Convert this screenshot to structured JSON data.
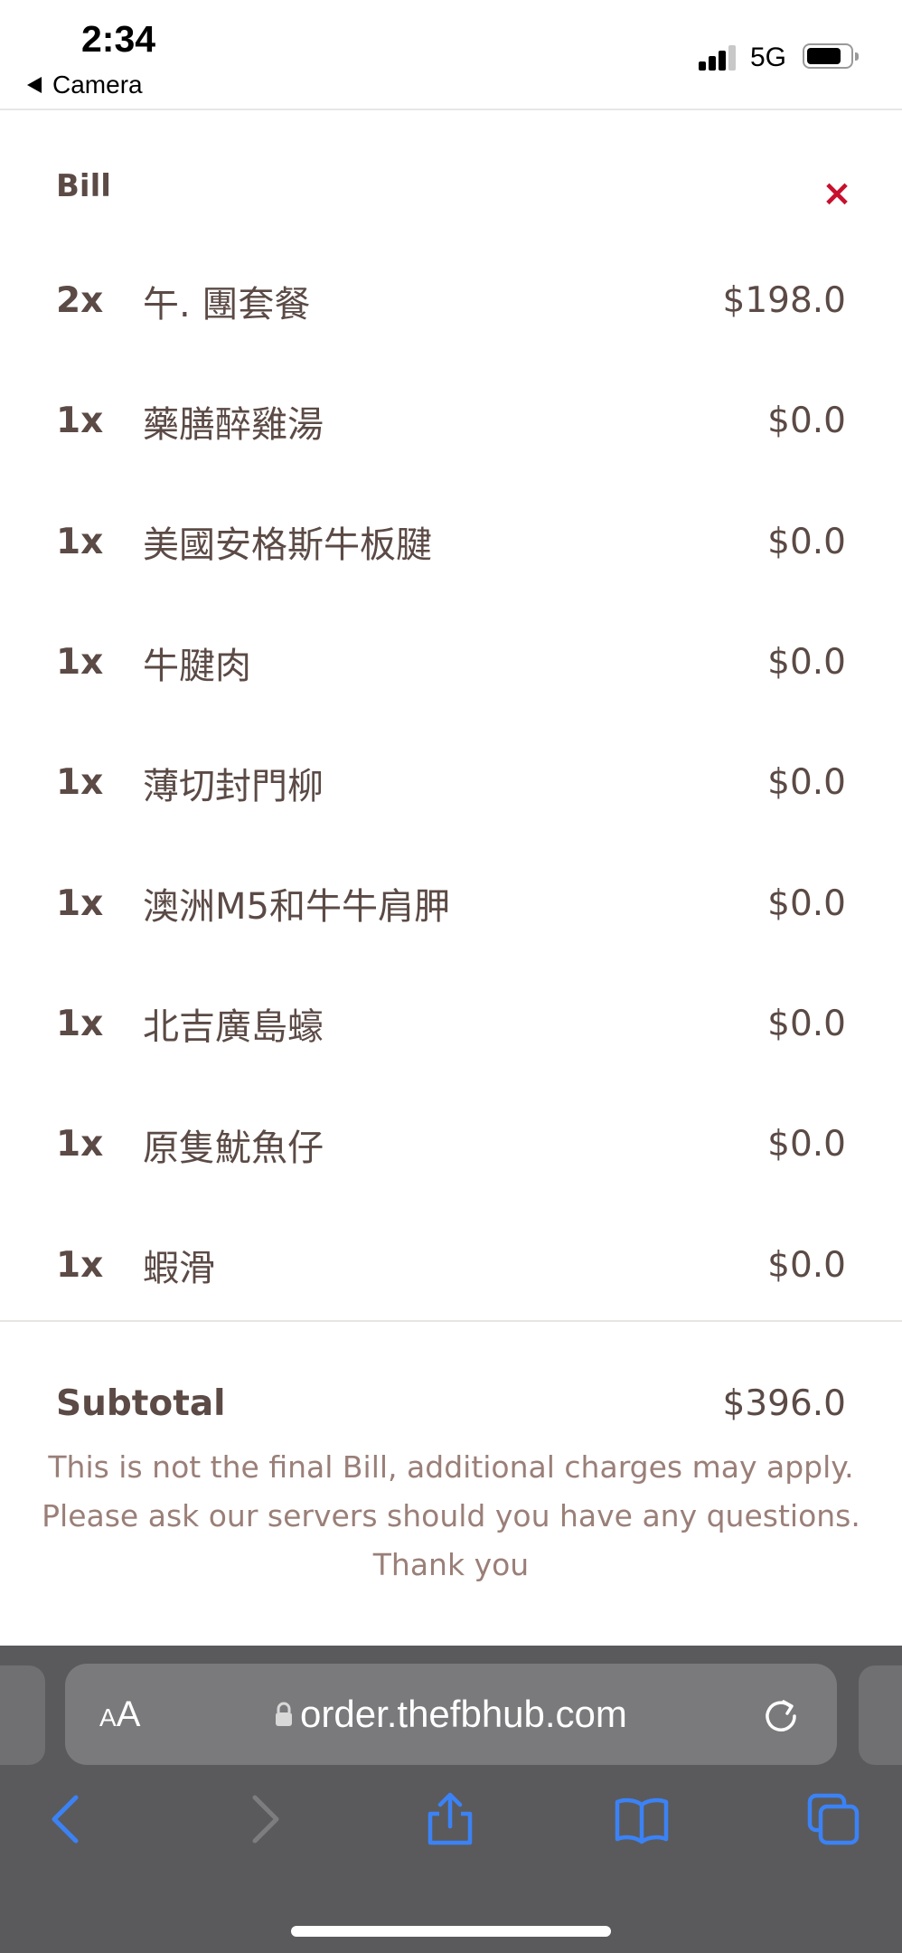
{
  "status_bar": {
    "time": "2:34",
    "back_app": "Camera",
    "network": "5G",
    "signal_bars": 3,
    "battery_level": 0.75
  },
  "bill": {
    "title": "Bill",
    "close_icon": "close-icon",
    "close_symbol": "×",
    "accent_color": "#c8102e",
    "text_color": "#5b4a45",
    "items": [
      {
        "qty": "2x",
        "name": "午. 團套餐",
        "price": "$198.0"
      },
      {
        "qty": "1x",
        "name": "藥膳醉雞湯",
        "price": "$0.0"
      },
      {
        "qty": "1x",
        "name": "美國安格斯牛板腱",
        "price": "$0.0"
      },
      {
        "qty": "1x",
        "name": "牛腱肉",
        "price": "$0.0"
      },
      {
        "qty": "1x",
        "name": "薄切封門柳",
        "price": "$0.0"
      },
      {
        "qty": "1x",
        "name": "澳洲M5和牛牛肩胛",
        "price": "$0.0"
      },
      {
        "qty": "1x",
        "name": "北吉廣島蠔",
        "price": "$0.0"
      },
      {
        "qty": "1x",
        "name": "原隻魷魚仔",
        "price": "$0.0"
      },
      {
        "qty": "1x",
        "name": "蝦滑",
        "price": "$0.0"
      }
    ],
    "subtotal_label": "Subtotal",
    "subtotal_value": "$396.0",
    "notice_lines": [
      "This is not the final Bill, additional charges may apply.",
      "Please ask our servers should you have any questions.",
      "Thank you"
    ]
  },
  "browser": {
    "text_size_small": "A",
    "text_size_big": "A",
    "url": "order.thefbhub.com",
    "icons": [
      "lock-icon",
      "reload-icon",
      "back-icon",
      "forward-icon",
      "share-icon",
      "bookmarks-icon",
      "tabs-icon"
    ],
    "toolbar_color": "#5a5a5c",
    "active_icon_color": "#3b82f6"
  }
}
